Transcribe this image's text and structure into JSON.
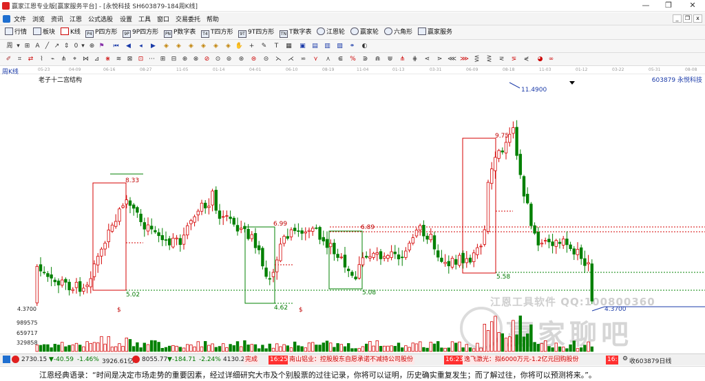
{
  "window": {
    "title": "赢家江恩专业版[赢家服务平台] - [永悦科技 SH603879-184周K线]",
    "minimize": "—",
    "restore": "❐",
    "close": "✕"
  },
  "menu": {
    "items": [
      "文件",
      "浏览",
      "资讯",
      "江恩",
      "公式选股",
      "设置",
      "工具",
      "窗口",
      "交易委托",
      "帮助"
    ],
    "mdi_buttons": [
      "_",
      "❐",
      "x"
    ]
  },
  "toolbar": {
    "items": [
      {
        "label": "行情",
        "icon": "quote-icon"
      },
      {
        "label": "板块",
        "icon": "sector-icon"
      },
      {
        "label": "K线",
        "icon": "kline-icon"
      },
      {
        "label": "P四方形",
        "icon": "P4"
      },
      {
        "label": "9P四方形",
        "icon": "9P"
      },
      {
        "label": "P数字表",
        "icon": "PN"
      },
      {
        "label": "T四方形",
        "icon": "T4"
      },
      {
        "label": "9T四方形",
        "icon": "9T"
      },
      {
        "label": "T数字表",
        "icon": "TN"
      },
      {
        "label": "江恩轮",
        "icon": "wheel-icon"
      },
      {
        "label": "赢家轮",
        "icon": "wheel-icon"
      },
      {
        "label": "六角形",
        "icon": "hexagon-icon"
      },
      {
        "label": "赢家服务",
        "icon": "service-icon"
      }
    ],
    "period_dropdown": "周"
  },
  "chart": {
    "period_label": "周K线",
    "title": "老子十二宫结构",
    "stock": "603879 永悦科技",
    "dates": [
      "05-23",
      "04-09",
      "06-16",
      "08-27",
      "11-05",
      "01-14",
      "04-01",
      "06-10",
      "08-19",
      "11-04",
      "01-13",
      "03-31",
      "06-09",
      "08-18",
      "11-03",
      "01-12",
      "03-22",
      "05-31",
      "08-08"
    ],
    "y_low_label": "4.3700",
    "volume_ticks": [
      "989575",
      "659717",
      "329858"
    ],
    "annotations": [
      {
        "text": "8.33",
        "color": "#c00000"
      },
      {
        "text": "5.02",
        "color": "#007a00"
      },
      {
        "text": "6.99",
        "color": "#c00000"
      },
      {
        "text": "4.62",
        "color": "#007a00"
      },
      {
        "text": "6.89",
        "color": "#c00000"
      },
      {
        "text": "5.08",
        "color": "#007a00"
      },
      {
        "text": "9.75",
        "color": "#c00000"
      },
      {
        "text": "11.4900",
        "color": "#1a3aa8"
      },
      {
        "text": "5.58",
        "color": "#007a00"
      },
      {
        "text": "4.3700",
        "color": "#1a3aa8"
      },
      {
        "text": "$",
        "color": "#c00000"
      },
      {
        "text": "$",
        "color": "#c00000"
      }
    ],
    "colors": {
      "up": "#d40000",
      "down": "#008000",
      "box_red": "#d40000",
      "box_green": "#008000"
    }
  },
  "watermark": {
    "line1": "江恩工具软件 QQ:100800360",
    "line2": "赢家聊吧"
  },
  "status": {
    "sh_index": "2730.15",
    "sh_change": "▼-40.59",
    "sh_pct": "-1.46%",
    "sh_amount": "3926.61亿",
    "sz_index": "8055.77",
    "sz_change": "▼-184.71",
    "sz_pct": "-2.24%",
    "sz_amount": "4130.24",
    "done": "完成",
    "news": [
      {
        "time": "16:25",
        "text": "南山铝业：控股股东自愿承诺不减持公司股份"
      },
      {
        "time": "16:23",
        "text": "逸飞激光：拟6000万元-1.2亿元回购股份"
      },
      {
        "time": "16:",
        "text": ""
      }
    ],
    "receive": "收603879日线"
  },
  "footer": {
    "quote": "江恩经典语录：“时间是决定市场走势的重要因素，经过详细研究大市及个别股票的过往记录，你将可以证明，历史确实重复发生；而了解过往，你将可以预测将来。”。"
  }
}
